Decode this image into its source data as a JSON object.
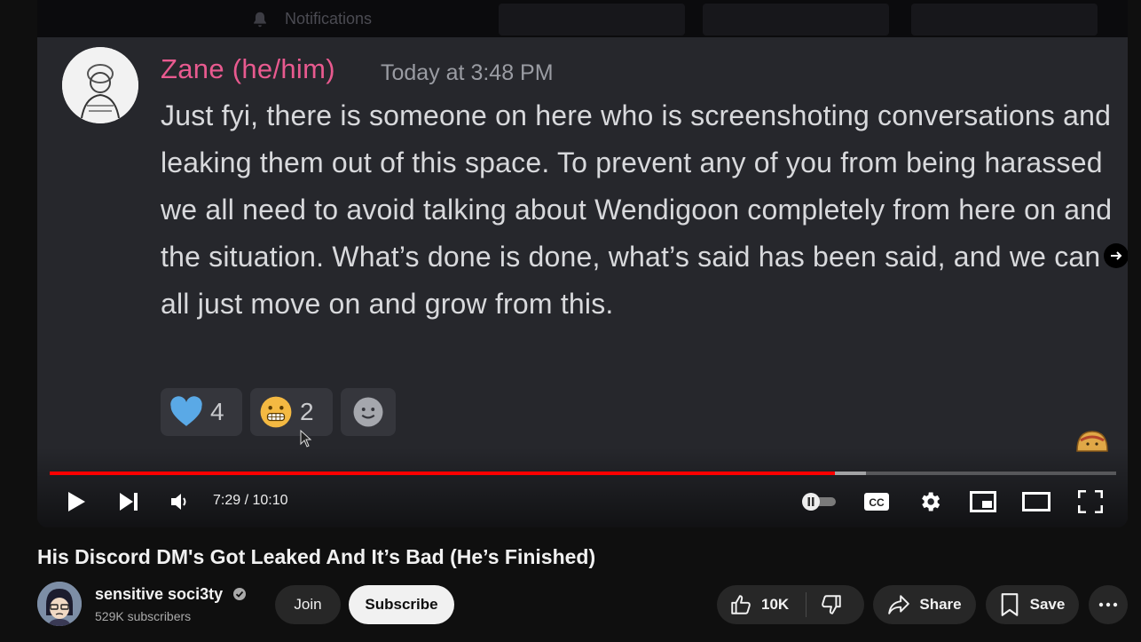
{
  "video_frame": {
    "top_bar": {
      "notifications_label": "Notifications"
    },
    "message": {
      "author": "Zane (he/him)",
      "timestamp": "Today at 3:48 PM",
      "text": "Just fyi, there is someone on here who is screenshoting conversations and leaking them out of this space. To prevent any of you from being harassed we all need to avoid talking about Wendigoon completely from here on and the situation. What’s done is done, what’s said has been said, and we can all just move on and grow from this.",
      "reactions": [
        {
          "icon": "blue-heart-icon",
          "count": "4"
        },
        {
          "icon": "grimacing-face-icon",
          "count": "2"
        },
        {
          "icon": "add-reaction-icon",
          "count": ""
        }
      ]
    }
  },
  "player": {
    "current_time": "7:29",
    "duration": "10:10",
    "time_display": "7:29 / 10:10",
    "progress_fraction": 0.736,
    "buffered_fraction": 0.765,
    "progress_color": "#ff0000",
    "autoplay": "paused",
    "controls": [
      "play-icon",
      "next-icon",
      "volume-icon",
      "autoplay-toggle",
      "captions-icon",
      "settings-icon",
      "miniplayer-icon",
      "theater-icon",
      "fullscreen-icon"
    ]
  },
  "video_title": "His Discord DM's Got Leaked And It’s Bad (He’s Finished)",
  "channel": {
    "name": "sensitive soci3ty",
    "subscribers": "529K subscribers",
    "verified": true,
    "join_label": "Join",
    "subscribe_label": "Subscribe"
  },
  "actions": {
    "like_count": "10K",
    "share_label": "Share",
    "save_label": "Save"
  },
  "colors": {
    "background": "#0f0f0f",
    "author_color": "#e85a8f",
    "pill_bg": "#272727"
  }
}
